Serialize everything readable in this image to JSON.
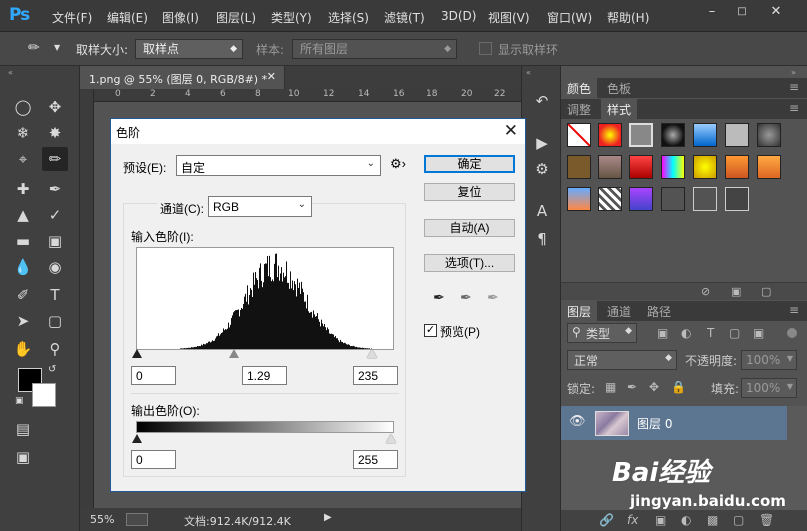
{
  "app": {
    "logo": "Ps",
    "menus": [
      "文件(F)",
      "编辑(E)",
      "图像(I)",
      "图层(L)",
      "类型(Y)",
      "选择(S)",
      "滤镜(T)",
      "3D(D)",
      "视图(V)",
      "窗口(W)",
      "帮助(H)"
    ]
  },
  "options": {
    "sample_size_label": "取样大小:",
    "sample_size_value": "取样点",
    "sample_label": "样本:",
    "sample_value": "所有图层",
    "show_ring_label": "显示取样环"
  },
  "document": {
    "tab_title": "1.png @ 55% (图层 0, RGB/8#) *",
    "ruler_ticks": [
      "0",
      "2",
      "4",
      "6",
      "8",
      "10",
      "12",
      "14",
      "16",
      "18",
      "20",
      "22"
    ],
    "zoom": "55%",
    "doc_size": "文档:912.4K/912.4K"
  },
  "panels": {
    "color_tabs": [
      "颜色",
      "色板"
    ],
    "style_tabs": [
      "调整",
      "样式"
    ],
    "layer_tabs": [
      "图层",
      "通道",
      "路径"
    ],
    "kind_filter": "类型",
    "blend_mode": "正常",
    "opacity_label": "不透明度:",
    "opacity_value": "100%",
    "lock_label": "锁定:",
    "fill_label": "填充:",
    "fill_value": "100%",
    "layer_name": "图层 0"
  },
  "dialog": {
    "title": "色阶",
    "preset_label": "预设(E):",
    "preset_value": "自定",
    "channel_label": "通道(C):",
    "channel_value": "RGB",
    "input_levels_label": "输入色阶(I):",
    "input_black": "0",
    "input_gamma": "1.29",
    "input_white": "235",
    "output_levels_label": "输出色阶(O):",
    "output_black": "0",
    "output_white": "255",
    "buttons": {
      "ok": "确定",
      "reset": "复位",
      "auto": "自动(A)",
      "options": "选项(T)..."
    },
    "preview_label": "预览(P)",
    "preview_checked": true
  },
  "watermark": {
    "brand": "Bai经验",
    "url": "jingyan.baidu.com"
  },
  "colors": {
    "accent": "#31a8ff",
    "panel_bg": "#535353",
    "dialog_bg": "#f0f0f0",
    "selected_layer": "#5c7590"
  }
}
